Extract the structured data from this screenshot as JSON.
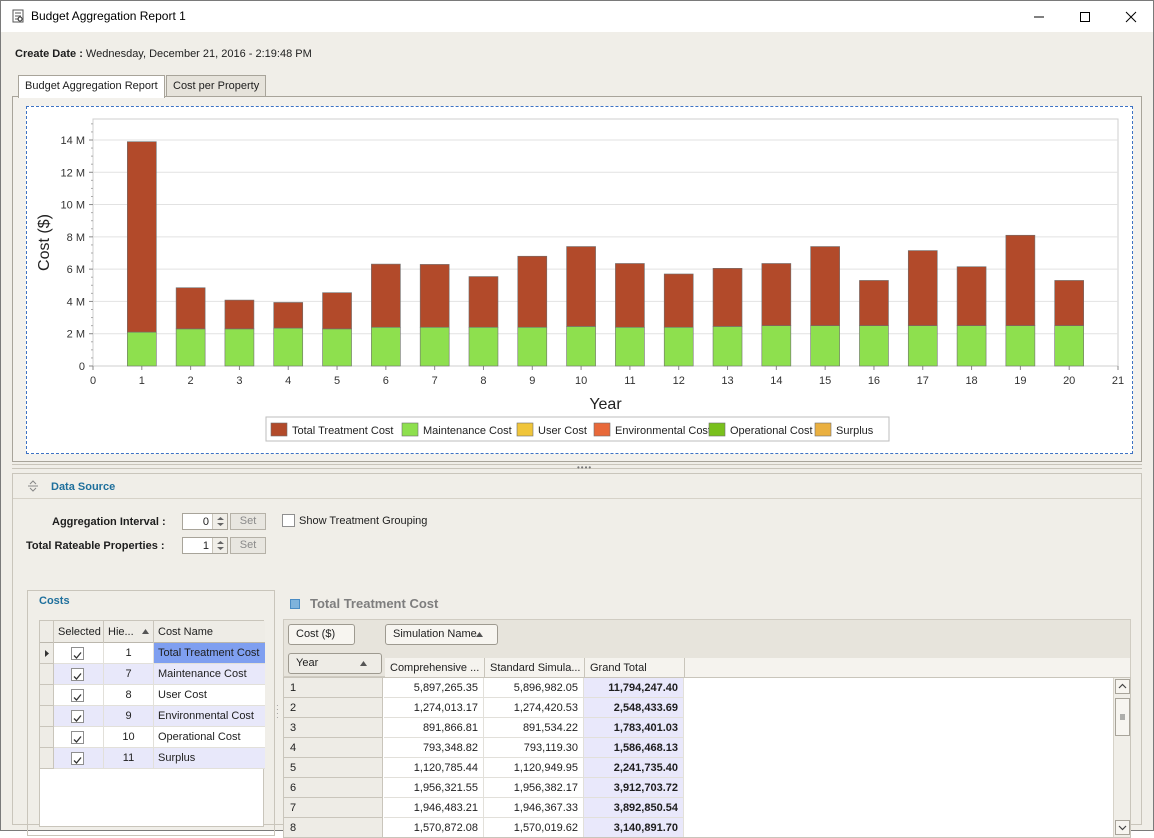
{
  "window": {
    "title": "Budget Aggregation Report 1",
    "controls": {
      "minimize": "—",
      "maximize": "☐",
      "close": "✕"
    }
  },
  "create_date": {
    "label": "Create Date :",
    "value": "Wednesday, December 21, 2016 - 2:19:48 PM"
  },
  "tabs": [
    {
      "label": "Budget Aggregation Report",
      "active": true
    },
    {
      "label": "Cost per Property",
      "active": false
    }
  ],
  "chart_data": {
    "type": "bar",
    "stacked": true,
    "xlabel": "Year",
    "ylabel": "Cost ($)",
    "x_ticks": [
      "0",
      "1",
      "2",
      "3",
      "4",
      "5",
      "6",
      "7",
      "8",
      "9",
      "10",
      "11",
      "12",
      "13",
      "14",
      "15",
      "16",
      "17",
      "18",
      "19",
      "20",
      "21"
    ],
    "y_ticks": [
      "0",
      "2 M",
      "4 M",
      "6 M",
      "8 M",
      "10 M",
      "12 M",
      "14 M"
    ],
    "ylim": [
      0,
      15300000
    ],
    "xlim": [
      0,
      21
    ],
    "grid": true,
    "legend_position": "bottom",
    "categories": [
      1,
      2,
      3,
      4,
      5,
      6,
      7,
      8,
      9,
      10,
      11,
      12,
      13,
      14,
      15,
      16,
      17,
      18,
      19,
      20
    ],
    "series": [
      {
        "name": "Maintenance Cost",
        "color": "#8ee04e",
        "values": [
          2100000,
          2300000,
          2300000,
          2350000,
          2300000,
          2400000,
          2400000,
          2400000,
          2400000,
          2450000,
          2400000,
          2400000,
          2450000,
          2500000,
          2500000,
          2500000,
          2500000,
          2500000,
          2500000,
          2500000
        ]
      },
      {
        "name": "Total Treatment Cost",
        "color": "#b24a2a",
        "values": [
          11794247,
          2548434,
          1783401,
          1586468,
          2241735,
          3912704,
          3892851,
          3140892,
          4400000,
          4950000,
          3950000,
          3300000,
          3600000,
          3850000,
          4900000,
          2800000,
          4650000,
          3650000,
          5600000,
          2800000
        ]
      }
    ],
    "legend": [
      {
        "name": "Total Treatment Cost",
        "color": "#b24a2a"
      },
      {
        "name": "Maintenance Cost",
        "color": "#8ee04e"
      },
      {
        "name": "User Cost",
        "color": "#f0c53a"
      },
      {
        "name": "Environmental Cost",
        "color": "#e8693a"
      },
      {
        "name": "Operational Cost",
        "color": "#79c01c"
      },
      {
        "name": "Surplus",
        "color": "#eab040"
      }
    ]
  },
  "data_source": {
    "title": "Data Source",
    "aggregation_interval": {
      "label": "Aggregation Interval :",
      "value": "0",
      "set_label": "Set"
    },
    "total_rateable": {
      "label": "Total Rateable Properties :",
      "value": "1",
      "set_label": "Set"
    },
    "show_grouping_label": "Show Treatment Grouping",
    "costs": {
      "title": "Costs",
      "columns": [
        "Selected",
        "Hie...",
        "Cost Name"
      ],
      "rows": [
        {
          "selected": true,
          "hier": "1",
          "name": "Total Treatment Cost",
          "current": true
        },
        {
          "selected": true,
          "hier": "7",
          "name": "Maintenance Cost",
          "current": false
        },
        {
          "selected": true,
          "hier": "8",
          "name": "User Cost",
          "current": false
        },
        {
          "selected": true,
          "hier": "9",
          "name": "Environmental Cost",
          "current": false
        },
        {
          "selected": true,
          "hier": "10",
          "name": "Operational Cost",
          "current": false
        },
        {
          "selected": true,
          "hier": "11",
          "name": "Surplus",
          "current": false
        }
      ]
    },
    "pivot": {
      "title": "Total Treatment Cost",
      "data_field": "Cost ($)",
      "column_field": "Simulation Name",
      "row_field": "Year",
      "columns": [
        "Comprehensive ...",
        "Standard Simula...",
        "Grand Total"
      ],
      "rows": [
        {
          "year": "1",
          "c1": "5,897,265.35",
          "c2": "5,896,982.05",
          "total": "11,794,247.40"
        },
        {
          "year": "2",
          "c1": "1,274,013.17",
          "c2": "1,274,420.53",
          "total": "2,548,433.69"
        },
        {
          "year": "3",
          "c1": "891,866.81",
          "c2": "891,534.22",
          "total": "1,783,401.03"
        },
        {
          "year": "4",
          "c1": "793,348.82",
          "c2": "793,119.30",
          "total": "1,586,468.13"
        },
        {
          "year": "5",
          "c1": "1,120,785.44",
          "c2": "1,120,949.95",
          "total": "2,241,735.40"
        },
        {
          "year": "6",
          "c1": "1,956,321.55",
          "c2": "1,956,382.17",
          "total": "3,912,703.72"
        },
        {
          "year": "7",
          "c1": "1,946,483.21",
          "c2": "1,946,367.33",
          "total": "3,892,850.54"
        },
        {
          "year": "8",
          "c1": "1,570,872.08",
          "c2": "1,570,019.62",
          "total": "3,140,891.70"
        }
      ]
    }
  }
}
